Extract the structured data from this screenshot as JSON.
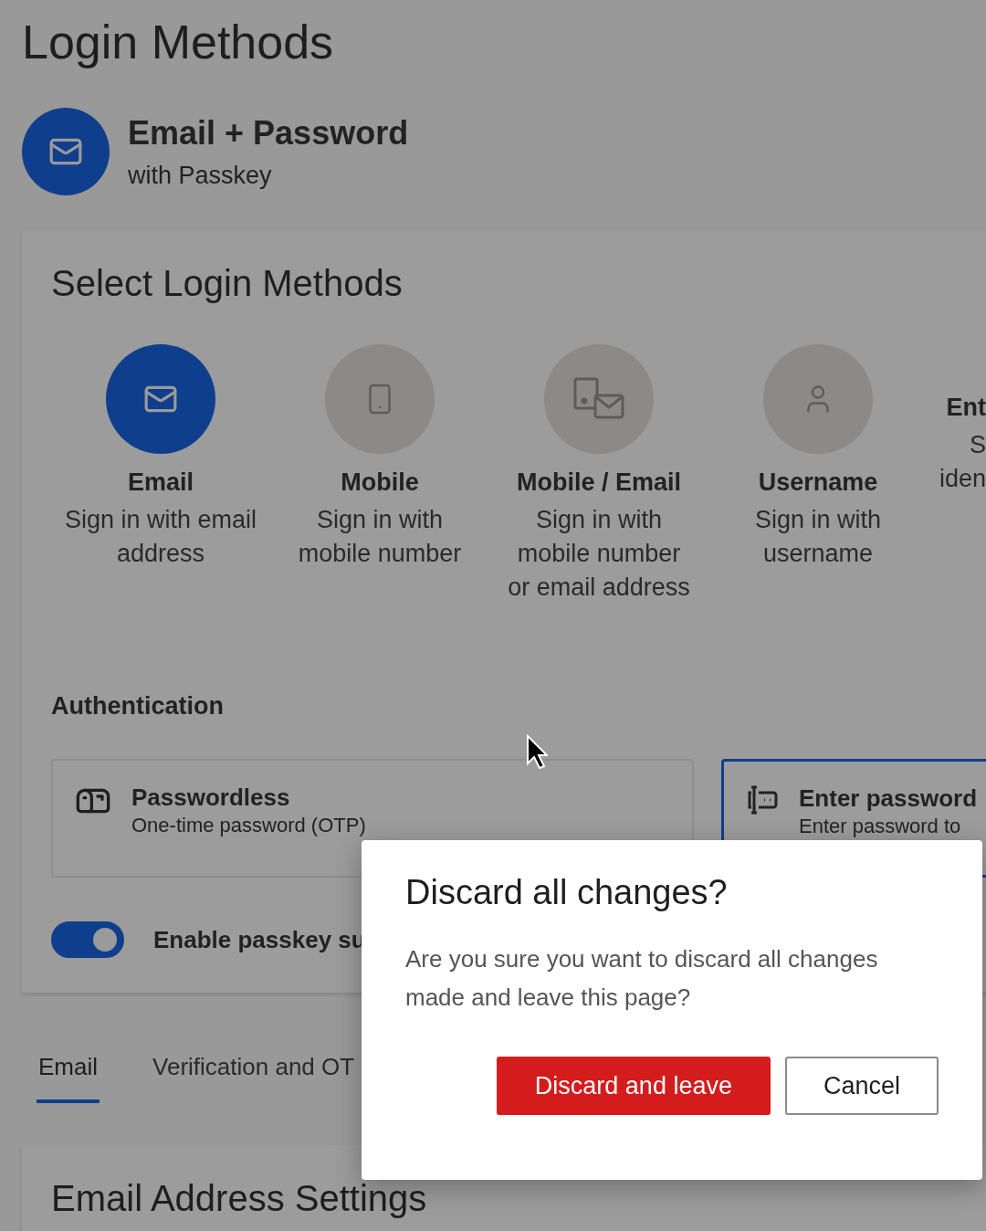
{
  "page_title": "Login Methods",
  "current_method": {
    "title": "Email + Password",
    "subtitle": "with Passkey"
  },
  "select_card": {
    "heading": "Select Login Methods",
    "methods": [
      {
        "kind": "email",
        "title": "Email",
        "description_lines": [
          "Sign in with email",
          "address"
        ],
        "selected": true
      },
      {
        "kind": "mobile",
        "title": "Mobile",
        "description_lines": [
          "Sign in with",
          "mobile number"
        ],
        "selected": false
      },
      {
        "kind": "mobile_email",
        "title": "Mobile / Email",
        "description_lines": [
          "Sign in with",
          "mobile number",
          "or email address"
        ],
        "selected": false
      },
      {
        "kind": "username",
        "title": "Username",
        "description_lines": [
          "Sign in with",
          "username"
        ],
        "selected": false
      },
      {
        "kind": "partial",
        "title": "Ent",
        "description_lines": [
          "S",
          "iden"
        ]
      }
    ]
  },
  "authentication": {
    "label": "Authentication",
    "options": [
      {
        "kind": "otp",
        "title": "Passwordless",
        "description": "One-time password (OTP)",
        "selected": false
      },
      {
        "kind": "password",
        "title": "Enter password",
        "description": "Enter password to",
        "selected": true
      }
    ],
    "passkey_toggle": {
      "label": "Enable passkey su",
      "on": true
    }
  },
  "tabs": [
    {
      "label": "Email",
      "selected": true
    },
    {
      "label": "Verification and OT",
      "selected": false
    }
  ],
  "email_settings": {
    "heading": "Email Address Settings"
  },
  "dialog": {
    "title": "Discard all changes?",
    "message": "Are you sure you want to discard all changes made and leave this page?",
    "buttons": [
      {
        "kind": "primary",
        "label": "Discard and leave"
      },
      {
        "kind": "secondary",
        "label": "Cancel"
      }
    ]
  }
}
